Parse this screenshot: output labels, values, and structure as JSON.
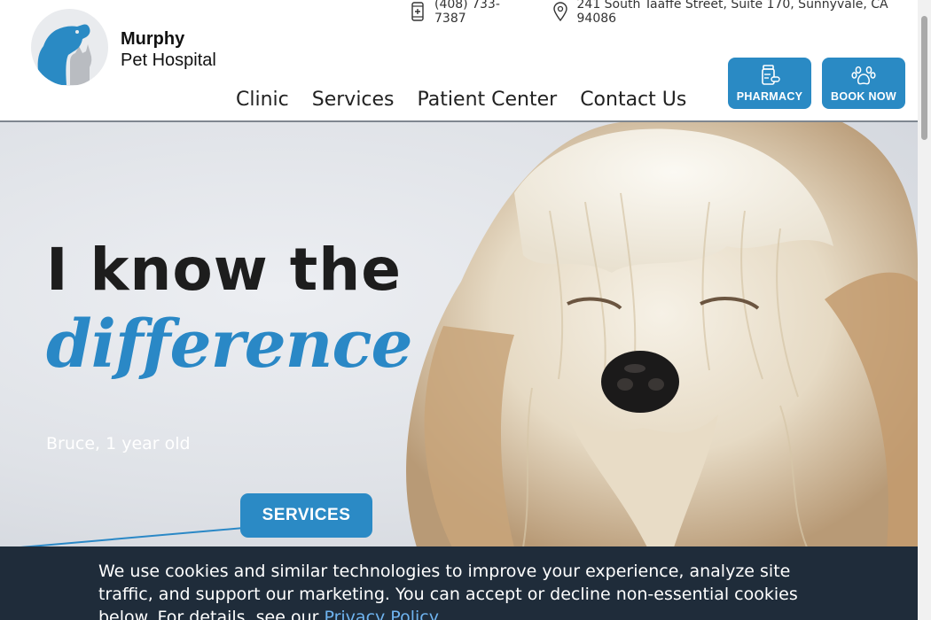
{
  "brand": {
    "name_line1": "Murphy",
    "name_line2": "Pet Hospital",
    "colors": {
      "primary": "#2a8ac4",
      "cat_gray": "#b9bcc1"
    }
  },
  "contact": {
    "phone": "(408) 733-7387",
    "phone_icon": "phone-icon",
    "address": "241 South Taaffe Street, Suite 170, Sunnyvale, CA 94086",
    "address_icon": "location-pin-icon"
  },
  "nav": {
    "items": [
      {
        "label": "Clinic"
      },
      {
        "label": "Services"
      },
      {
        "label": "Patient Center"
      },
      {
        "label": "Contact Us"
      }
    ]
  },
  "cta": {
    "pharmacy": {
      "label": "PHARMACY",
      "icon": "pill-bottle-icon"
    },
    "book": {
      "label": "BOOK NOW",
      "icon": "paw-icon"
    }
  },
  "hero": {
    "title": "I know the",
    "subtitle": "difference",
    "caption": "Bruce, 1 year old",
    "button_label": "SERVICES"
  },
  "cookie": {
    "text": "We use cookies and similar technologies to improve your experience, analyze site traffic, and support our marketing. You can accept or decline non-essential cookies below. For details, see our ",
    "link": "Privacy Policy"
  }
}
